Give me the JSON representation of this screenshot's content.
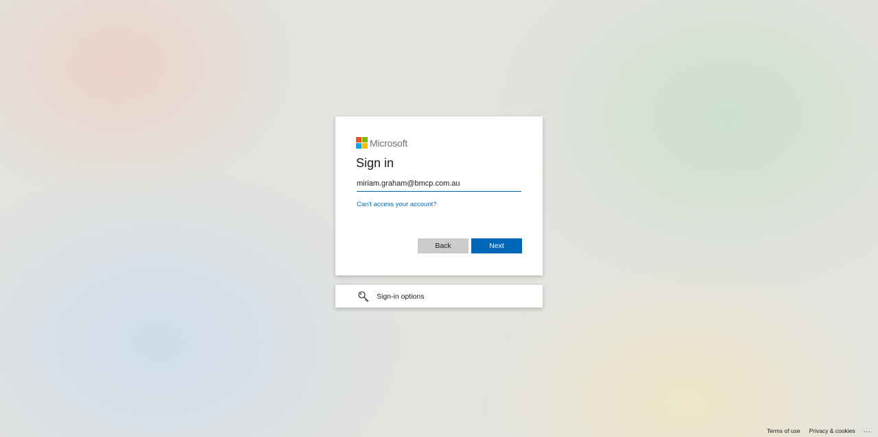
{
  "brand": {
    "name": "Microsoft"
  },
  "signin": {
    "title": "Sign in",
    "email_value": "miriam.graham@bmcp.com.au",
    "cant_access_label": "Can't access your account?",
    "back_label": "Back",
    "next_label": "Next"
  },
  "options": {
    "label": "Sign-in options",
    "icon": "key-icon"
  },
  "footer": {
    "terms_label": "Terms of use",
    "privacy_label": "Privacy & cookies",
    "more_label": "..."
  },
  "colors": {
    "accent": "#0067b8",
    "button_secondary": "#cccccc"
  }
}
